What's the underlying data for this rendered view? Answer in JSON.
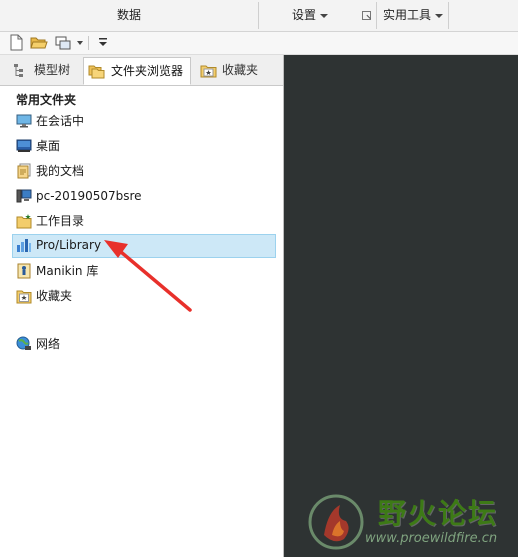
{
  "ribbon": {
    "data_label": "数据",
    "settings_label": "设置",
    "tools_label": "实用工具"
  },
  "tabs": [
    {
      "label": "模型树",
      "icon": "model-tree-icon",
      "active": false
    },
    {
      "label": "文件夹浏览器",
      "icon": "folder-browser-icon",
      "active": true
    },
    {
      "label": "收藏夹",
      "icon": "favorites-icon",
      "active": false
    }
  ],
  "folders": {
    "title": "常用文件夹",
    "items": [
      {
        "label": "在会话中",
        "icon": "monitor-icon"
      },
      {
        "label": "桌面",
        "icon": "desktop-icon"
      },
      {
        "label": "我的文档",
        "icon": "documents-icon"
      },
      {
        "label": "pc-20190507bsre",
        "icon": "computer-icon"
      },
      {
        "label": "工作目录",
        "icon": "working-directory-icon"
      },
      {
        "label": "Pro/Library",
        "icon": "library-icon",
        "selected": true
      },
      {
        "label": "Manikin 库",
        "icon": "manikin-icon"
      },
      {
        "label": "收藏夹",
        "icon": "favorites-icon"
      }
    ],
    "network": {
      "label": "网络",
      "icon": "network-icon"
    }
  },
  "watermark": {
    "title": "野火论坛",
    "url": "www.proewildfire.cn"
  },
  "colors": {
    "selection_bg": "#cde8f7",
    "selection_border": "#9cd2ee",
    "canvas": "#2e3333",
    "arrow": "#e8302b",
    "watermark_green": "#3d7a16"
  }
}
